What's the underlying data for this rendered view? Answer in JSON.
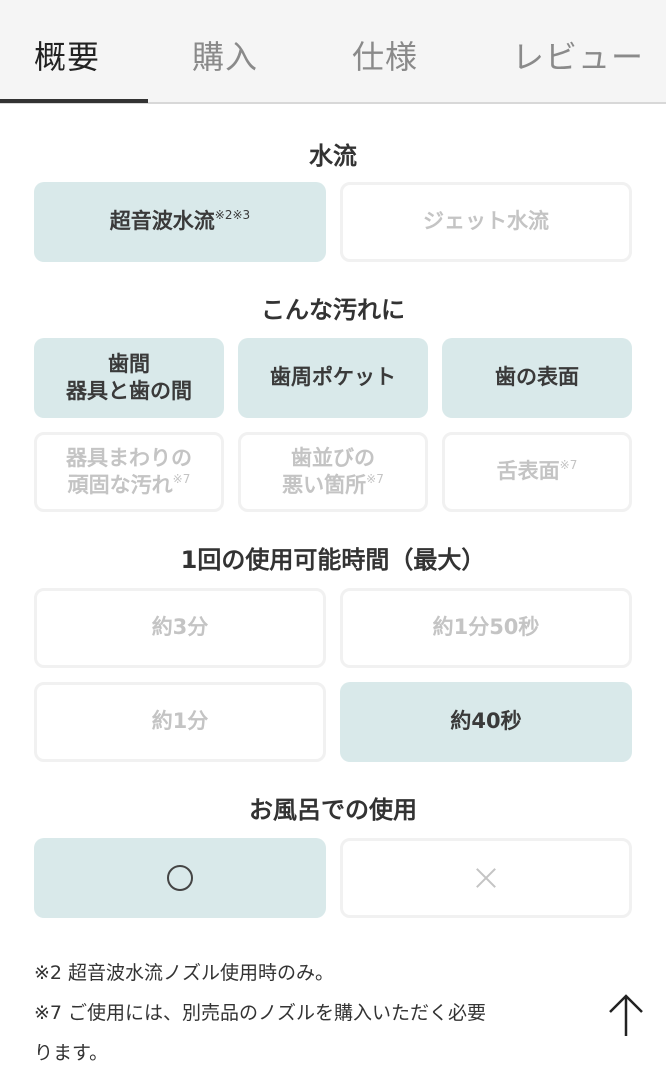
{
  "tabs": [
    {
      "label": "概要",
      "active": true
    },
    {
      "label": "購入",
      "active": false
    },
    {
      "label": "仕様",
      "active": false
    },
    {
      "label": "レビュー",
      "active": false
    }
  ],
  "sections": {
    "water_flow": {
      "title": "水流",
      "options": [
        {
          "label": "超音波水流",
          "note": "※2※3",
          "selected": true
        },
        {
          "label": "ジェット水流",
          "selected": false
        }
      ]
    },
    "stains": {
      "title": "こんな汚れに",
      "options": [
        {
          "line1": "歯間",
          "line2": "器具と歯の間",
          "selected": true
        },
        {
          "label": "歯周ポケット",
          "selected": true
        },
        {
          "label": "歯の表面",
          "selected": true
        },
        {
          "line1": "器具まわりの",
          "line2": "頑固な汚れ",
          "note": "※7",
          "selected": false
        },
        {
          "line1": "歯並びの",
          "line2": "悪い箇所",
          "note": "※7",
          "selected": false
        },
        {
          "label": "舌表面",
          "note": "※7",
          "selected": false
        }
      ]
    },
    "usage_time": {
      "title": "1回の使用可能時間（最大）",
      "options": [
        {
          "label": "約3分",
          "selected": false
        },
        {
          "label": "約1分50秒",
          "selected": false
        },
        {
          "label": "約1分",
          "selected": false
        },
        {
          "label": "約40秒",
          "selected": true
        }
      ]
    },
    "bath": {
      "title": "お風呂での使用",
      "options": [
        {
          "icon": "circle-icon",
          "selected": true
        },
        {
          "icon": "cross-icon",
          "selected": false
        }
      ]
    }
  },
  "footnotes": [
    "※2 超音波水流ノズル使用時のみ。",
    "※7 ご使用には、別売品のノズルを購入いただく必要",
    "ります。"
  ],
  "colors": {
    "selected_bg": "#d9e9ea",
    "unselected_border": "#f1f1f1",
    "unselected_text": "#c4c4c4",
    "tab_bg": "#f5f5f5"
  }
}
